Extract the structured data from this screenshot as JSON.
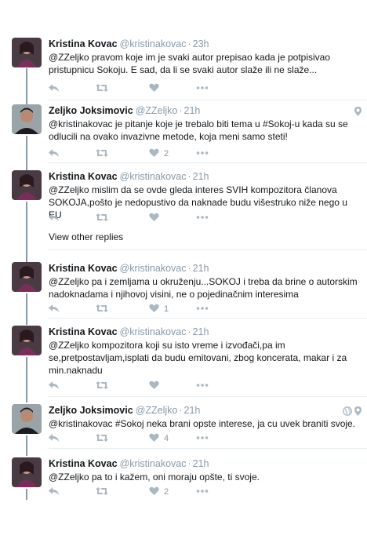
{
  "tweets": [
    {
      "author": "Kristina Kovac",
      "handle": "@kristinakovac",
      "time": "23h",
      "text": "@ZZeljko pravom koje im je svaki autor prepisao kada je potpisivao pristupnicu Sokoju. E sad, da li se svaki autor slaže ili ne slaže...",
      "likes": ""
    },
    {
      "author": "Zeljko Joksimovic",
      "handle": "@ZZeljko",
      "time": "21h",
      "text": "@kristinakovac je pitanje koje je trebalo biti tema u #Sokoj-u kada su se odlucili na ovako invazivne metode, koja meni samo steti!",
      "likes": "2"
    },
    {
      "author": "Kristina Kovac",
      "handle": "@kristinakovac",
      "time": "21h",
      "text": "@ZZeljko mislim da se ovde gleda interes SVIH kompozitora članova SOKOJA,pošto je nedopustivo da naknade budu višestruko niže nego u EU",
      "likes": ""
    },
    {
      "author": "Kristina Kovac",
      "handle": "@kristinakovac",
      "time": "21h",
      "text": "@ZZeljko pa i zemljama u okruženju...SOKOJ i treba da brine o autorskim nadoknadama i njihovoj visini, ne o pojedinačnim interesima",
      "likes": "1"
    },
    {
      "author": "Kristina Kovac",
      "handle": "@kristinakovac",
      "time": "21h",
      "text": "@ZZeljko kompozitora koji su isto vreme i izvođači,pa im se,pretpostavljam,isplati da budu emitovani, zbog koncerata, makar i za min.naknadu",
      "likes": ""
    },
    {
      "author": "Zeljko Joksimovic",
      "handle": "@ZZeljko",
      "time": "21h",
      "text": "@kristinakovac #Sokoj neka brani opste interese, ja cu uvek braniti svoje.",
      "likes": "4"
    },
    {
      "author": "Kristina Kovac",
      "handle": "@kristinakovac",
      "time": "21h",
      "text": "@ZZeljko pa to i kažem, oni moraju opšte, ti svoje.",
      "likes": "2"
    }
  ],
  "view_other_replies": "View other replies",
  "separator": "·",
  "icons": {
    "reply": "reply-icon",
    "retweet": "retweet-icon",
    "like": "heart-icon",
    "more": "more-icon",
    "location": "location-pin-icon",
    "globe": "globe-icon"
  },
  "colors": {
    "icon_gray": "#aab8c2",
    "meta_gray": "#8899a6",
    "thread_line": "#8899a6"
  }
}
